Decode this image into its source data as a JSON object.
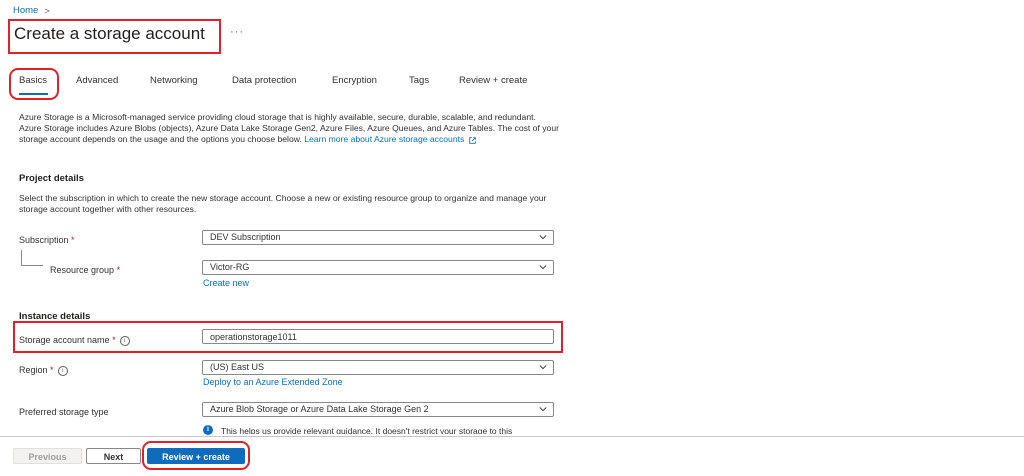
{
  "breadcrumb": {
    "home": "Home",
    "separator": ">"
  },
  "page": {
    "title": "Create a storage account",
    "more": "···"
  },
  "tabs": [
    {
      "label": "Basics",
      "selected": true
    },
    {
      "label": "Advanced"
    },
    {
      "label": "Networking"
    },
    {
      "label": "Data protection"
    },
    {
      "label": "Encryption"
    },
    {
      "label": "Tags"
    },
    {
      "label": "Review + create"
    }
  ],
  "intro": {
    "text": "Azure Storage is a Microsoft-managed service providing cloud storage that is highly available, secure, durable, scalable, and redundant. Azure Storage includes Azure Blobs (objects), Azure Data Lake Storage Gen2, Azure Files, Azure Queues, and Azure Tables. The cost of your storage account depends on the usage and the options you choose below.",
    "link": "Learn more about Azure storage accounts"
  },
  "project": {
    "heading": "Project details",
    "description": "Select the subscription in which to create the new storage account. Choose a new or existing resource group to organize and manage your storage account together with other resources.",
    "subscription_label": "Subscription",
    "subscription_value": "DEV Subscription",
    "resource_group_label": "Resource group",
    "resource_group_value": "Victor-RG",
    "create_new": "Create new"
  },
  "instance": {
    "heading": "Instance details",
    "name_label": "Storage account name",
    "name_value": "operationstorage1011",
    "region_label": "Region",
    "region_value": "(US) East US",
    "region_link": "Deploy to an Azure Extended Zone",
    "storage_type_label": "Preferred storage type",
    "storage_type_value": "Azure Blob Storage or Azure Data Lake Storage Gen 2",
    "storage_type_hint": "This helps us provide relevant guidance. It doesn't restrict your storage to this"
  },
  "required_mark": "*",
  "footer": {
    "previous": "Previous",
    "next": "Next",
    "review": "Review + create"
  },
  "colors": {
    "accent": "#0f6cbd",
    "highlight": "#e0202a",
    "required": "#a4262c"
  }
}
